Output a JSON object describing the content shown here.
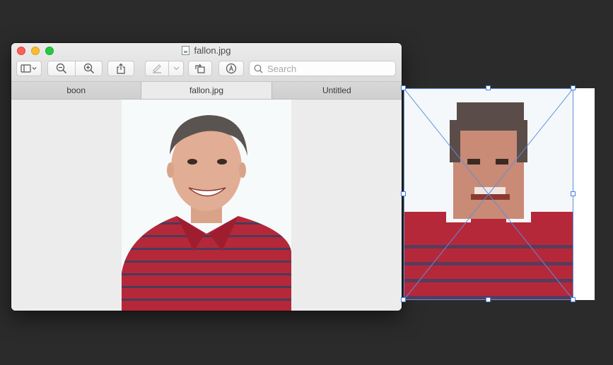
{
  "window": {
    "title": "fallon.jpg",
    "toolbar": {
      "sidebar_icon": "sidebar-icon",
      "zoom_out_icon": "zoom-out-icon",
      "zoom_in_icon": "zoom-in-icon",
      "share_icon": "share-icon",
      "markup_icon": "pen-icon",
      "rotate_icon": "rotate-icon",
      "annotate_icon": "annotate-icon",
      "search_placeholder": "Search"
    },
    "tabs": [
      {
        "label": "boon",
        "active": false
      },
      {
        "label": "fallon.jpg",
        "active": true
      },
      {
        "label": "Untitled",
        "active": false
      }
    ]
  },
  "colors": {
    "desktop": "#2b2b2b",
    "shirt": "#b5283a",
    "selection": "#4a7fd8"
  }
}
